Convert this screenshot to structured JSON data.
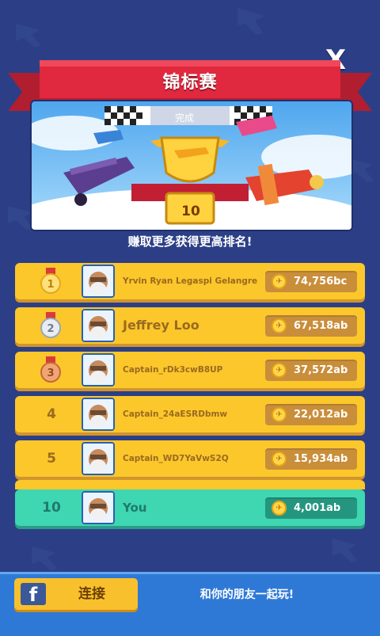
{
  "header": {
    "title": "锦标赛",
    "close_label": "X"
  },
  "hero": {
    "status_label": "完成",
    "trophy_number": "10"
  },
  "subtitle": "赚取更多获得更高排名!",
  "leaderboard": [
    {
      "rank": "1",
      "medal": "gold",
      "name": "Yrvin Ryan Legaspi Gelangre",
      "score": "74,756bc"
    },
    {
      "rank": "2",
      "medal": "silver",
      "name": "Jeffrey Loo",
      "score": "67,518ab"
    },
    {
      "rank": "3",
      "medal": "bronze",
      "name": "Captain_rDk3cwB8UP",
      "score": "37,572ab"
    },
    {
      "rank": "4",
      "medal": "",
      "name": "Captain_24aESRDbmw",
      "score": "22,012ab"
    },
    {
      "rank": "5",
      "medal": "",
      "name": "Captain_WD7YaVwS2Q",
      "score": "15,934ab"
    }
  ],
  "player": {
    "rank": "10",
    "name": "You",
    "score": "4,001ab"
  },
  "footer": {
    "connect_label": "连接",
    "facebook_glyph": "f",
    "invite_text": "和你的朋友一起玩!"
  },
  "colors": {
    "background": "#2c3f86",
    "row": "#fcc72b",
    "player_row": "#3fd6b2",
    "banner": "#e0283e",
    "footer": "#2f79d6"
  }
}
